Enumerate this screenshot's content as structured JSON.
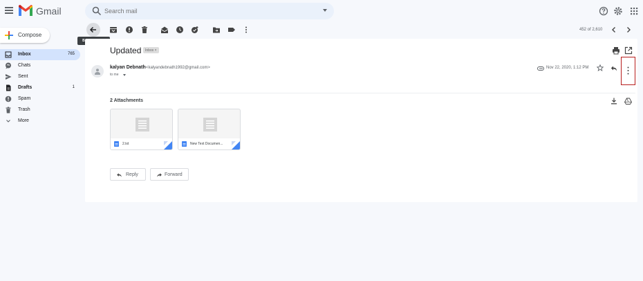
{
  "header": {
    "brand": "Gmail",
    "search_placeholder": "Search mail"
  },
  "sidebar": {
    "compose_label": "Compose",
    "items": [
      {
        "label": "Inbox",
        "count": "765",
        "icon": "inbox-icon"
      },
      {
        "label": "Chats",
        "count": "",
        "icon": "chat-icon"
      },
      {
        "label": "Sent",
        "count": "",
        "icon": "send-icon"
      },
      {
        "label": "Drafts",
        "count": "1",
        "icon": "draft-icon"
      },
      {
        "label": "Spam",
        "count": "",
        "icon": "spam-icon"
      },
      {
        "label": "Trash",
        "count": "",
        "icon": "trash-icon"
      },
      {
        "label": "More",
        "count": "",
        "icon": "chevron-down-icon"
      }
    ]
  },
  "toolbar": {
    "tooltip": "Back to Inbox",
    "page_count": "452 of 2,610"
  },
  "message": {
    "subject": "Updated",
    "label_chip": "Inbox ×",
    "sender_name": "kalyan Debnath",
    "sender_email": "<kalyandebnath1992@gmail.com>",
    "to": "to me",
    "date": "Nov 22, 2020, 1:12 PM",
    "attachments_title": "2 Attachments",
    "attachments": [
      {
        "name": "2.txt"
      },
      {
        "name": "New Text Documen..."
      }
    ],
    "reply_label": "Reply",
    "forward_label": "Forward"
  },
  "colors": {
    "background": "#f6f8fc",
    "active_nav": "#d3e3fd",
    "highlight_box": "#b71c1c",
    "attachment_accent": "#4285f4"
  }
}
